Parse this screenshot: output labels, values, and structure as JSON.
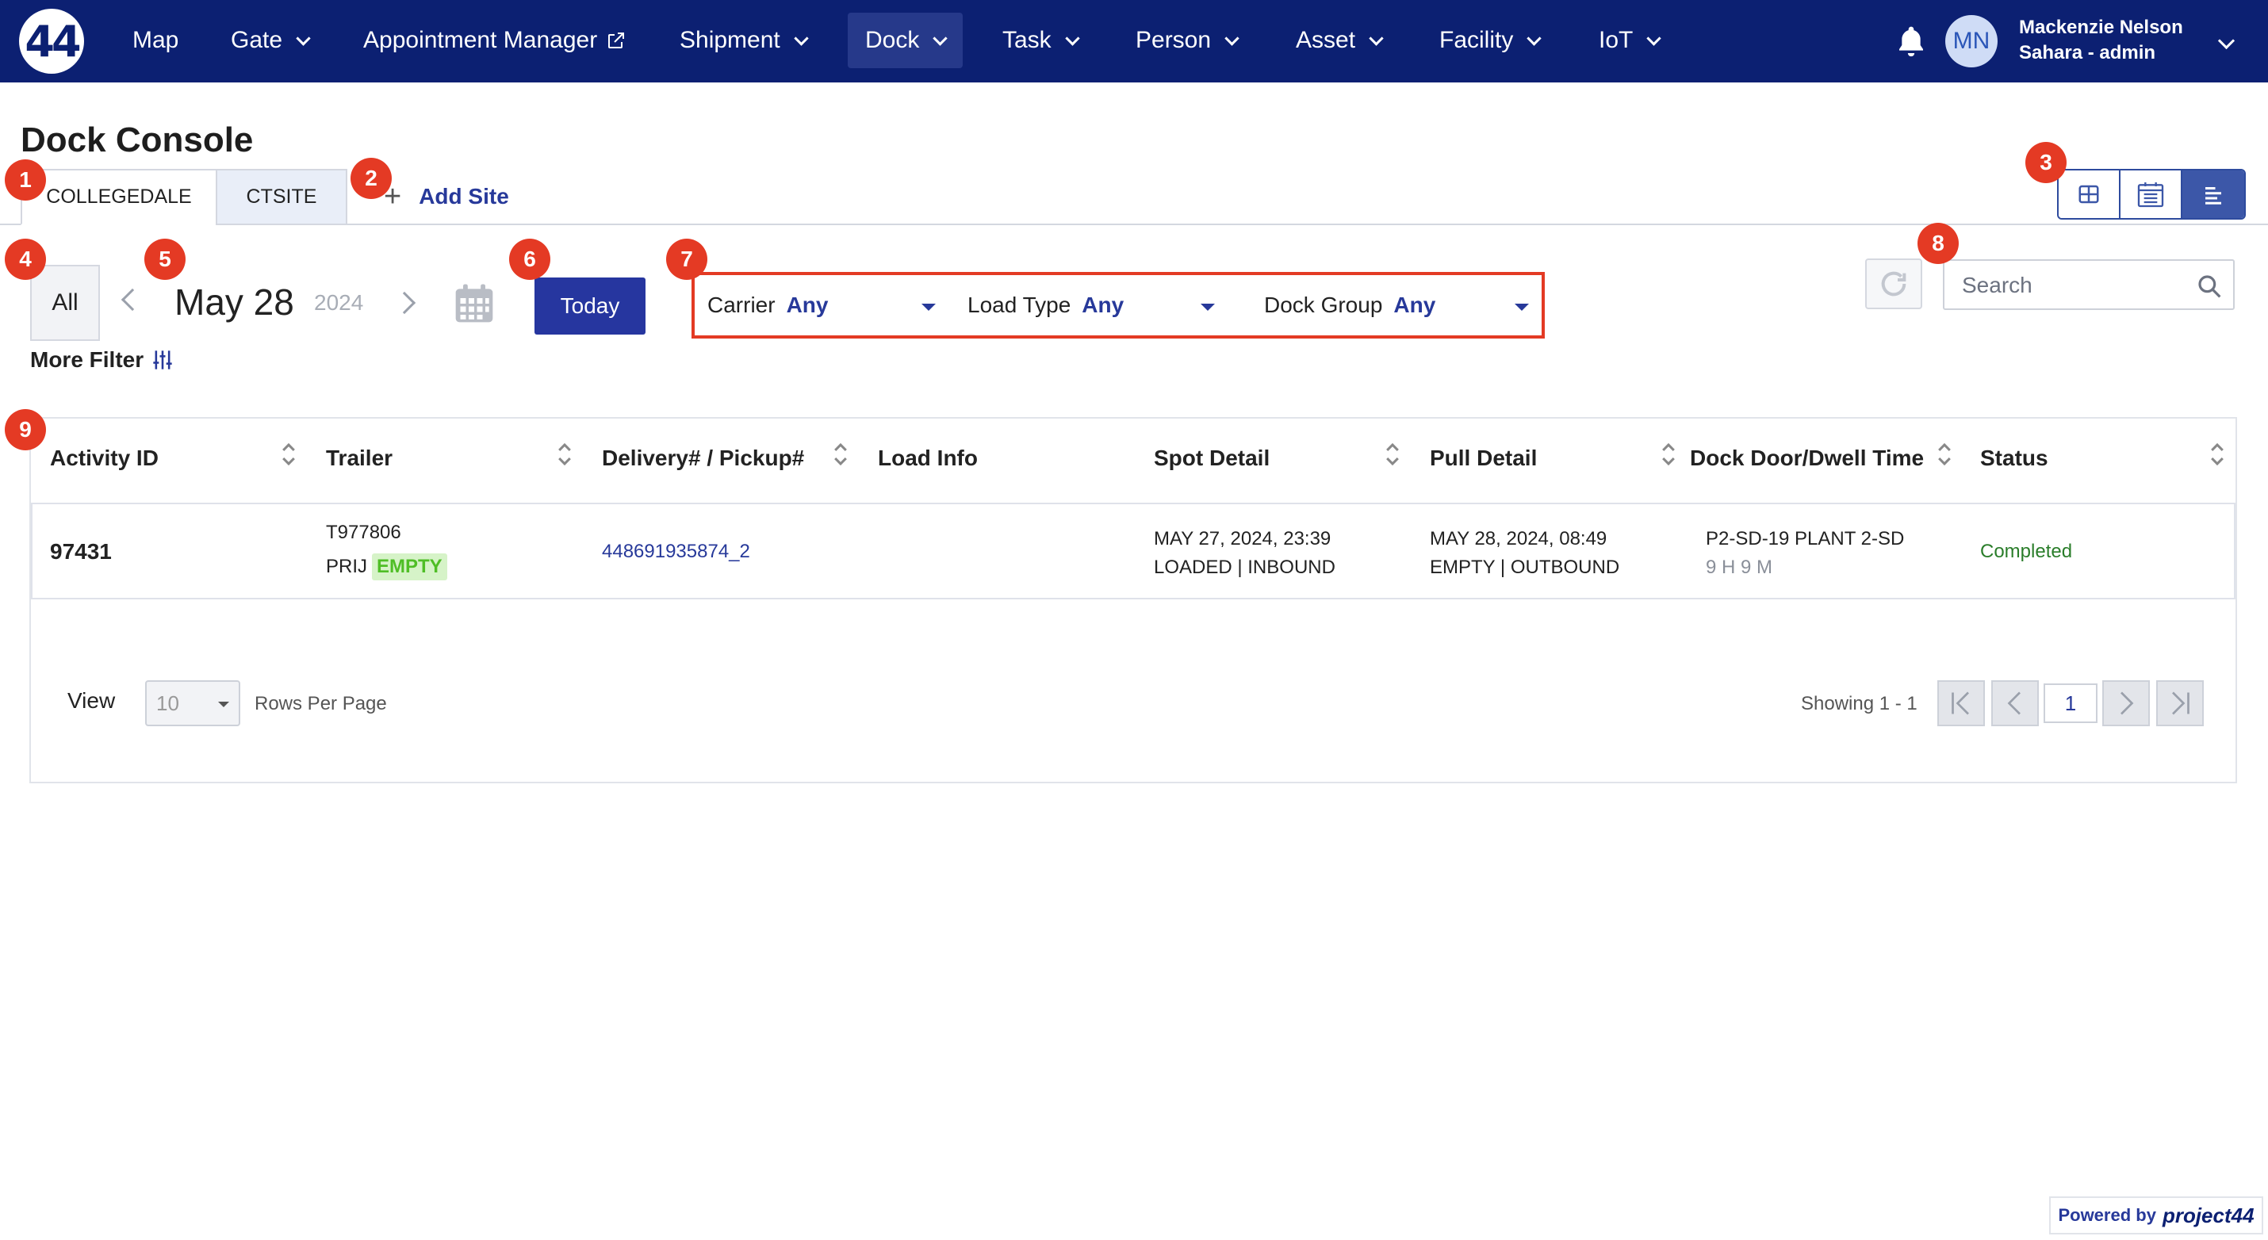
{
  "nav": {
    "logo": "44",
    "items": [
      {
        "label": "Map",
        "dropdown": false
      },
      {
        "label": "Gate",
        "dropdown": true
      },
      {
        "label": "Appointment Manager",
        "dropdown": false,
        "external": true
      },
      {
        "label": "Shipment",
        "dropdown": true
      },
      {
        "label": "Dock",
        "dropdown": true,
        "active": true
      },
      {
        "label": "Task",
        "dropdown": true
      },
      {
        "label": "Person",
        "dropdown": true
      },
      {
        "label": "Asset",
        "dropdown": true
      },
      {
        "label": "Facility",
        "dropdown": true
      },
      {
        "label": "IoT",
        "dropdown": true
      }
    ],
    "user": {
      "initials": "MN",
      "name": "Mackenzie Nelson",
      "role": "Sahara - admin"
    }
  },
  "page": {
    "title": "Dock Console"
  },
  "sites": {
    "tabs": [
      {
        "label": "COLLEGEDALE",
        "active": true
      },
      {
        "label": "CTSITE",
        "active": false
      }
    ],
    "add_label": "Add Site"
  },
  "view_modes": [
    "grid-view-icon",
    "calendar-view-icon",
    "list-view-icon"
  ],
  "controls": {
    "all_label": "All",
    "date": {
      "day": "May 28",
      "year": "2024"
    },
    "today_label": "Today",
    "more_filter_label": "More Filter",
    "search_placeholder": "Search"
  },
  "filters": [
    {
      "label": "Carrier",
      "value": "Any"
    },
    {
      "label": "Load Type",
      "value": "Any"
    },
    {
      "label": "Dock Group",
      "value": "Any"
    }
  ],
  "table": {
    "columns": [
      "Activity ID",
      "Trailer",
      "Delivery# / Pickup#",
      "Load Info",
      "Spot Detail",
      "Pull Detail",
      "Dock Door/Dwell Time",
      "Status"
    ],
    "rows": [
      {
        "activity_id": "97431",
        "trailer_id": "T977806",
        "trailer_carrier": "PRIJ",
        "trailer_status": "EMPTY",
        "delivery": "448691935874_2",
        "load_info": "",
        "spot_time": "MAY 27, 2024, 23:39",
        "spot_state": "LOADED | INBOUND",
        "pull_time": "MAY 28, 2024, 08:49",
        "pull_state": "EMPTY | OUTBOUND",
        "dock_door": "P2-SD-19 PLANT 2-SD",
        "dwell": "9 H 9 M",
        "status": "Completed"
      }
    ]
  },
  "pagination": {
    "view_label": "View",
    "rows_value": "10",
    "rows_per_page_label": "Rows Per Page",
    "showing": "Showing 1 - 1",
    "current_page": "1"
  },
  "markers": [
    "1",
    "2",
    "3",
    "4",
    "5",
    "6",
    "7",
    "8",
    "9"
  ],
  "footer": {
    "powered_by": "Powered by",
    "brand": "project44"
  },
  "colors": {
    "nav_bg": "#0c2072",
    "accent": "#26369f",
    "highlight": "#e33a24",
    "status_completed": "#2a7d2a",
    "badge_empty": "#4fbe26"
  }
}
